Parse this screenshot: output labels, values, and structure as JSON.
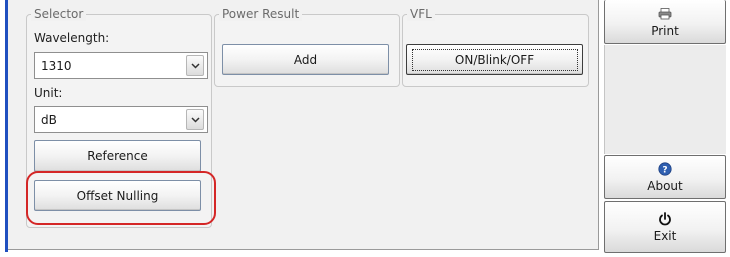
{
  "groups": {
    "selector": {
      "title": "Selector",
      "wavelength_label": "Wavelength:",
      "wavelength_value": "1310",
      "unit_label": "Unit:",
      "unit_value": "dB",
      "reference_label": "Reference",
      "offset_nulling_label": "Offset Nulling"
    },
    "power_result": {
      "title": "Power Result",
      "add_label": "Add"
    },
    "vfl": {
      "title": "VFL",
      "toggle_label": "ON/Blink/OFF"
    }
  },
  "sidebar": {
    "print_label": "Print",
    "print_icon": "printer-icon",
    "about_label": "About",
    "about_icon": "help-icon",
    "exit_label": "Exit",
    "exit_icon": "power-icon"
  },
  "colors": {
    "highlight": "#d42626",
    "accent_strip": "#1f4fbf",
    "help_icon": "#2f5fb0"
  }
}
